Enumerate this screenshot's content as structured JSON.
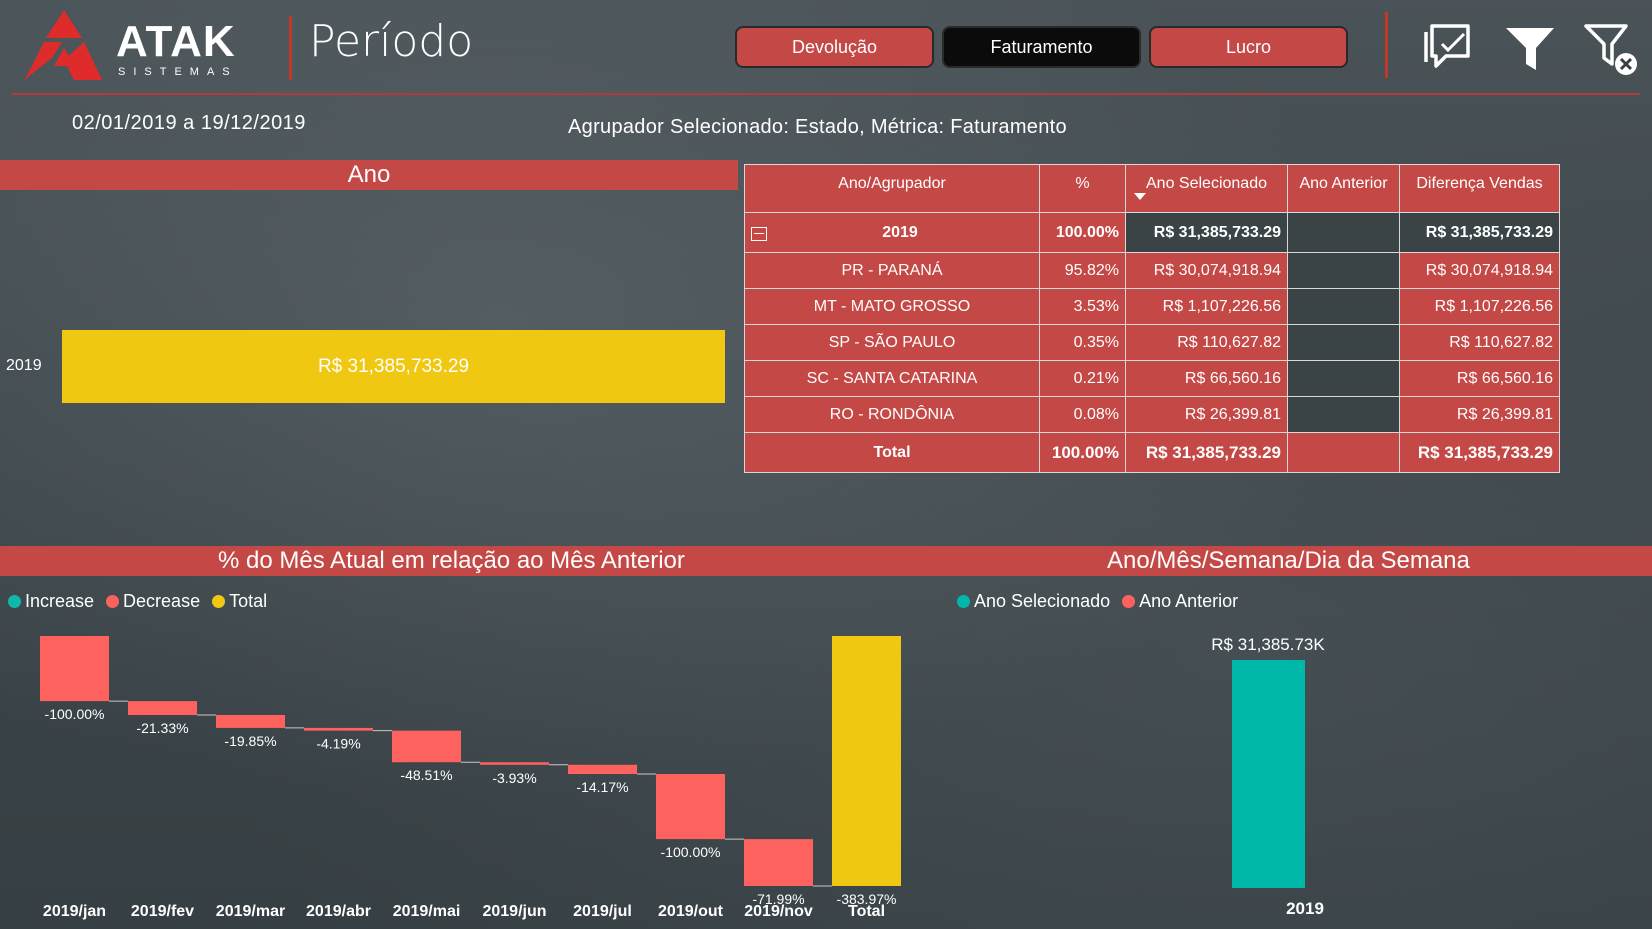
{
  "header": {
    "logo_text": "ATAK",
    "logo_sub": "SISTEMAS",
    "title": "Período",
    "buttons": [
      "Devolução",
      "Faturamento",
      "Lucro"
    ],
    "active_button": "Faturamento",
    "icons": [
      "comment-icon",
      "filter-icon",
      "clear-filter-icon"
    ]
  },
  "date_range": "02/01/2019 a 19/12/2019",
  "selection_info": "Agrupador Selecionado: Estado, Métrica: Faturamento",
  "colors": {
    "accent": "#c44846",
    "total": "#f0c812",
    "increase": "#10b8a8",
    "decrease": "#fd625e",
    "ano_selecionado": "#00b8aa",
    "ano_anterior": "#fd625e"
  },
  "ano_section": {
    "title": "Ano",
    "chart_data": {
      "type": "bar",
      "categories": [
        "2019"
      ],
      "values": [
        31385733.29
      ],
      "value_labels": [
        "R$ 31,385,733.29"
      ]
    }
  },
  "table": {
    "headers": [
      "Ano/Agrupador",
      "%",
      "Ano Selecionado",
      "Ano Anterior",
      "Diferença Vendas"
    ],
    "group": {
      "label": "2019",
      "pct": "100.00%",
      "selected": "R$ 31,385,733.29",
      "previous": "",
      "diff": "R$ 31,385,733.29"
    },
    "rows": [
      {
        "label": "PR - PARANÁ",
        "pct": "95.82%",
        "selected": "R$ 30,074,918.94",
        "previous": "",
        "diff": "R$ 30,074,918.94"
      },
      {
        "label": "MT - MATO GROSSO",
        "pct": "3.53%",
        "selected": "R$ 1,107,226.56",
        "previous": "",
        "diff": "R$ 1,107,226.56"
      },
      {
        "label": "SP - SÃO PAULO",
        "pct": "0.35%",
        "selected": "R$ 110,627.82",
        "previous": "",
        "diff": "R$ 110,627.82"
      },
      {
        "label": "SC - SANTA CATARINA",
        "pct": "0.21%",
        "selected": "R$ 66,560.16",
        "previous": "",
        "diff": "R$ 66,560.16"
      },
      {
        "label": "RO - RONDÔNIA",
        "pct": "0.08%",
        "selected": "R$ 26,399.81",
        "previous": "",
        "diff": "R$ 26,399.81"
      }
    ],
    "total": {
      "label": "Total",
      "pct": "100.00%",
      "selected": "R$ 31,385,733.29",
      "previous": "",
      "diff": "R$ 31,385,733.29"
    }
  },
  "mes_section": {
    "title": "% do Mês Atual em relação ao Mês Anterior",
    "legend": [
      "Increase",
      "Decrease",
      "Total"
    ]
  },
  "dia_section": {
    "title": "Ano/Mês/Semana/Dia da Semana",
    "legend": [
      "Ano Selecionado",
      "Ano Anterior"
    ]
  },
  "chart_data": [
    {
      "type": "bar",
      "subtype": "waterfall",
      "title": "% do Mês Atual em relação ao Mês Anterior",
      "categories": [
        "2019/jan",
        "2019/fev",
        "2019/mar",
        "2019/abr",
        "2019/mai",
        "2019/jun",
        "2019/jul",
        "2019/out",
        "2019/nov",
        "Total"
      ],
      "values": [
        -100.0,
        -21.33,
        -19.85,
        -4.19,
        -48.51,
        -3.93,
        -14.17,
        -100.0,
        -71.99,
        -383.97
      ],
      "labels": [
        "-100.00%",
        "-21.33%",
        "-19.85%",
        "-4.19%",
        "-48.51%",
        "-3.93%",
        "-14.17%",
        "-100.00%",
        "-71.99%",
        "-383.97%"
      ],
      "series_kinds": [
        "Decrease",
        "Decrease",
        "Decrease",
        "Decrease",
        "Decrease",
        "Decrease",
        "Decrease",
        "Decrease",
        "Decrease",
        "Total"
      ],
      "legend": [
        "Increase",
        "Decrease",
        "Total"
      ],
      "legend_position": "top-left"
    },
    {
      "type": "bar",
      "title": "Ano/Mês/Semana/Dia da Semana",
      "categories": [
        "2019"
      ],
      "series": [
        {
          "name": "Ano Selecionado",
          "values": [
            31385.73
          ]
        },
        {
          "name": "Ano Anterior",
          "values": [
            0
          ]
        }
      ],
      "value_label": "R$ 31,385.73K",
      "legend": [
        "Ano Selecionado",
        "Ano Anterior"
      ],
      "legend_position": "top-left"
    }
  ]
}
